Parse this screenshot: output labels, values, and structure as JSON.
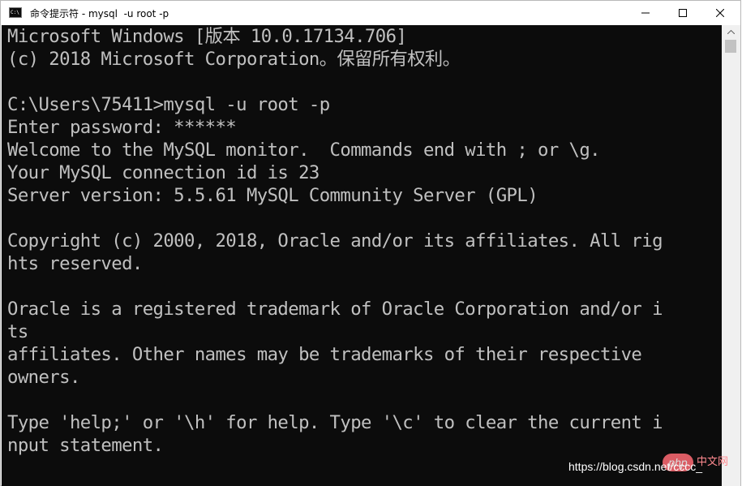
{
  "window": {
    "title": "命令提示符 - mysql  -u root -p",
    "icon": "cmd-icon",
    "controls": {
      "minimize_glyph": "minimize-icon",
      "maximize_glyph": "maximize-icon",
      "close_glyph": "close-icon"
    }
  },
  "console": {
    "lines": [
      "Microsoft Windows [版本 10.0.17134.706]",
      "(c) 2018 Microsoft Corporation。保留所有权利。",
      "",
      "C:\\Users\\75411>mysql -u root -p",
      "Enter password: ******",
      "Welcome to the MySQL monitor.  Commands end with ; or \\g.",
      "Your MySQL connection id is 23",
      "Server version: 5.5.61 MySQL Community Server (GPL)",
      "",
      "Copyright (c) 2000, 2018, Oracle and/or its affiliates. All rig",
      "hts reserved.",
      "",
      "Oracle is a registered trademark of Oracle Corporation and/or i",
      "ts",
      "affiliates. Other names may be trademarks of their respective",
      "owners.",
      "",
      "Type 'help;' or '\\h' for help. Type '\\c' to clear the current i",
      "nput statement."
    ],
    "background": "#0c0c0c",
    "text_color": "#c0c0c0"
  },
  "watermark": {
    "url": "https://blog.csdn.net/cccc_",
    "logo": "php",
    "logo_suffix": "中文网"
  }
}
